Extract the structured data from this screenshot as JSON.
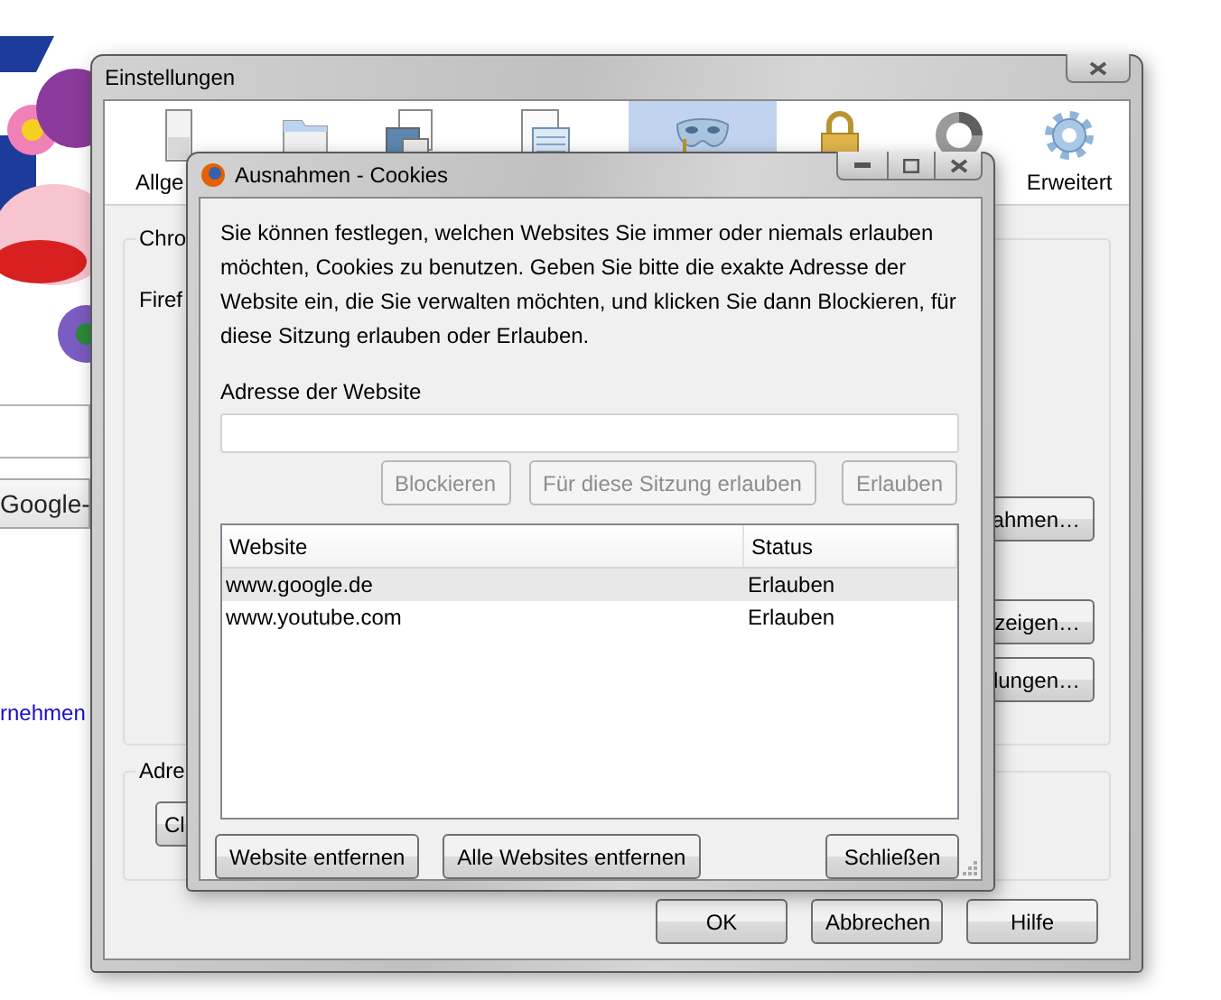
{
  "background_page": {
    "button": "Google-",
    "link": "rnehmen"
  },
  "settings_window": {
    "title": "Einstellungen",
    "toolbar": [
      {
        "label": "Allge",
        "selected": false
      },
      {
        "selected": false
      },
      {
        "selected": false
      },
      {
        "selected": false
      },
      {
        "selected": true
      },
      {
        "selected": false
      },
      {
        "selected": false
      },
      {
        "label": "Erweitert",
        "selected": false
      }
    ],
    "group_1": {
      "legend": "Chro",
      "text": "Firef",
      "buttons": [
        "ahmen…",
        "zeigen…",
        "lungen…"
      ]
    },
    "group_2": {
      "legend": "Adre",
      "buttons": [
        "Cl"
      ]
    },
    "buttons": [
      "OK",
      "Abbrechen",
      "Hilfe"
    ]
  },
  "dialog": {
    "title": "Ausnahmen - Cookies",
    "description": "Sie können festlegen, welchen Websites Sie immer oder niemals erlauben möchten, Cookies zu benutzen. Geben Sie bitte die exakte Adresse der Website ein, die Sie verwalten möchten, und klicken Sie dann Blockieren, für diese Sitzung erlauben oder Erlauben.",
    "address_label": "Adresse der Website",
    "actions": [
      {
        "label": "Blockieren",
        "disabled": true
      },
      {
        "label": "Für diese Sitzung erlauben",
        "disabled": true
      },
      {
        "label": "Erlauben",
        "disabled": true
      }
    ],
    "table": {
      "columns": [
        "Website",
        "Status"
      ],
      "rows": [
        {
          "website": "www.google.de",
          "status": "Erlauben",
          "selected": true
        },
        {
          "website": "www.youtube.com",
          "status": "Erlauben",
          "selected": false
        }
      ]
    },
    "buttons": [
      "Website entfernen",
      "Alle Websites entfernen",
      "Schließen"
    ]
  }
}
